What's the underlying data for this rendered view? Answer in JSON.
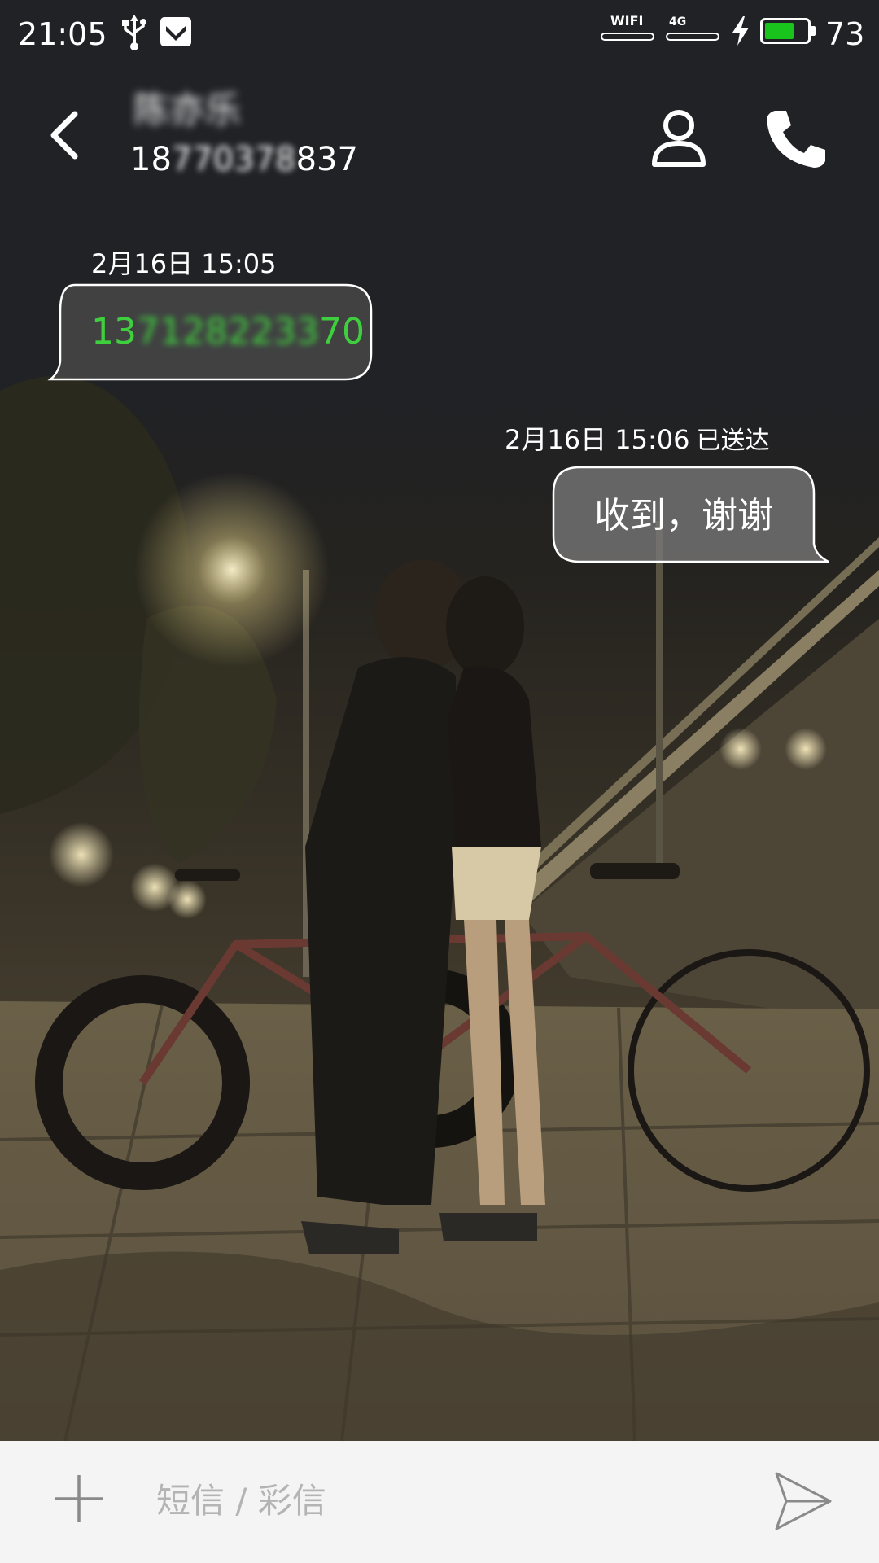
{
  "status_bar": {
    "time": "21:05",
    "wifi_label": "WIFI",
    "network_label": "4G",
    "battery_level": "73",
    "battery_fraction": 0.73,
    "battery_color": "#19c51c",
    "icons": [
      "usb-icon",
      "mail-icon",
      "wifi-signal-icon",
      "cellular-signal-icon",
      "charging-icon",
      "battery-icon"
    ]
  },
  "header": {
    "contact_name": "陈亦乐",
    "contact_number_visible": "18",
    "contact_number_hidden": "770378",
    "contact_number_end": "837",
    "icons": [
      "back-arrow-icon",
      "person-icon",
      "phone-icon"
    ]
  },
  "messages": [
    {
      "direction": "incoming",
      "timestamp": "2月16日 15:05",
      "text_visible_start": "13",
      "text_hidden": "71282233",
      "text_visible_end": "70",
      "text_color": "#3fcf3e"
    },
    {
      "direction": "outgoing",
      "timestamp": "2月16日 15:06",
      "status": "已送达",
      "text": "收到，谢谢"
    }
  ],
  "composer": {
    "placeholder": "短信 / 彩信",
    "icons": [
      "add-icon",
      "send-icon"
    ]
  }
}
